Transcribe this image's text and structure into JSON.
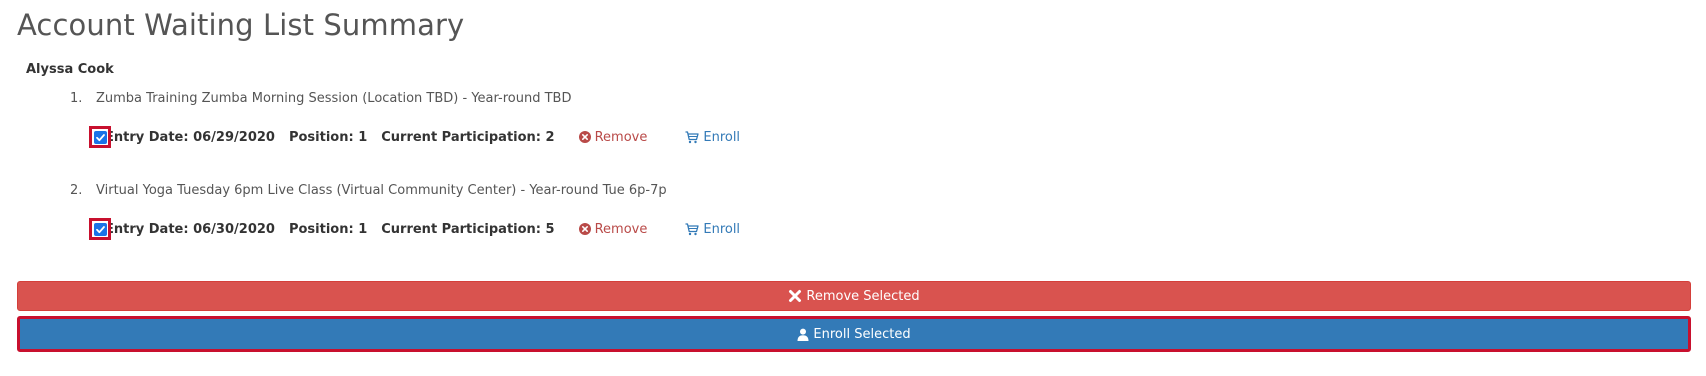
{
  "page": {
    "title": "Account Waiting List Summary",
    "account_name": "Alyssa Cook"
  },
  "entries": [
    {
      "number": "1.",
      "title": "Zumba Training Zumba Morning Session (Location TBD) - Year-round TBD",
      "checked": true,
      "entry_date_label": "Entry Date:",
      "entry_date": "06/29/2020",
      "position_label": "Position:",
      "position": "1",
      "participation_label": "Current Participation:",
      "participation": "2",
      "remove_label": "Remove",
      "enroll_label": "Enroll"
    },
    {
      "number": "2.",
      "title": "Virtual Yoga Tuesday 6pm Live Class (Virtual Community Center) - Year-round Tue 6p-7p",
      "checked": true,
      "entry_date_label": "Entry Date:",
      "entry_date": "06/30/2020",
      "position_label": "Position:",
      "position": "1",
      "participation_label": "Current Participation:",
      "participation": "5",
      "remove_label": "Remove",
      "enroll_label": "Enroll"
    }
  ],
  "actions": {
    "remove_selected_label": "Remove Selected",
    "enroll_selected_label": "Enroll Selected"
  },
  "colors": {
    "remove": "#d9534f",
    "enroll": "#337ab7",
    "highlight": "#c8102e",
    "checkbox": "#1a73e8"
  },
  "icons": {
    "remove": "times-circle-icon",
    "enroll": "cart-icon",
    "remove_selected": "close-icon",
    "enroll_selected": "user-icon"
  }
}
